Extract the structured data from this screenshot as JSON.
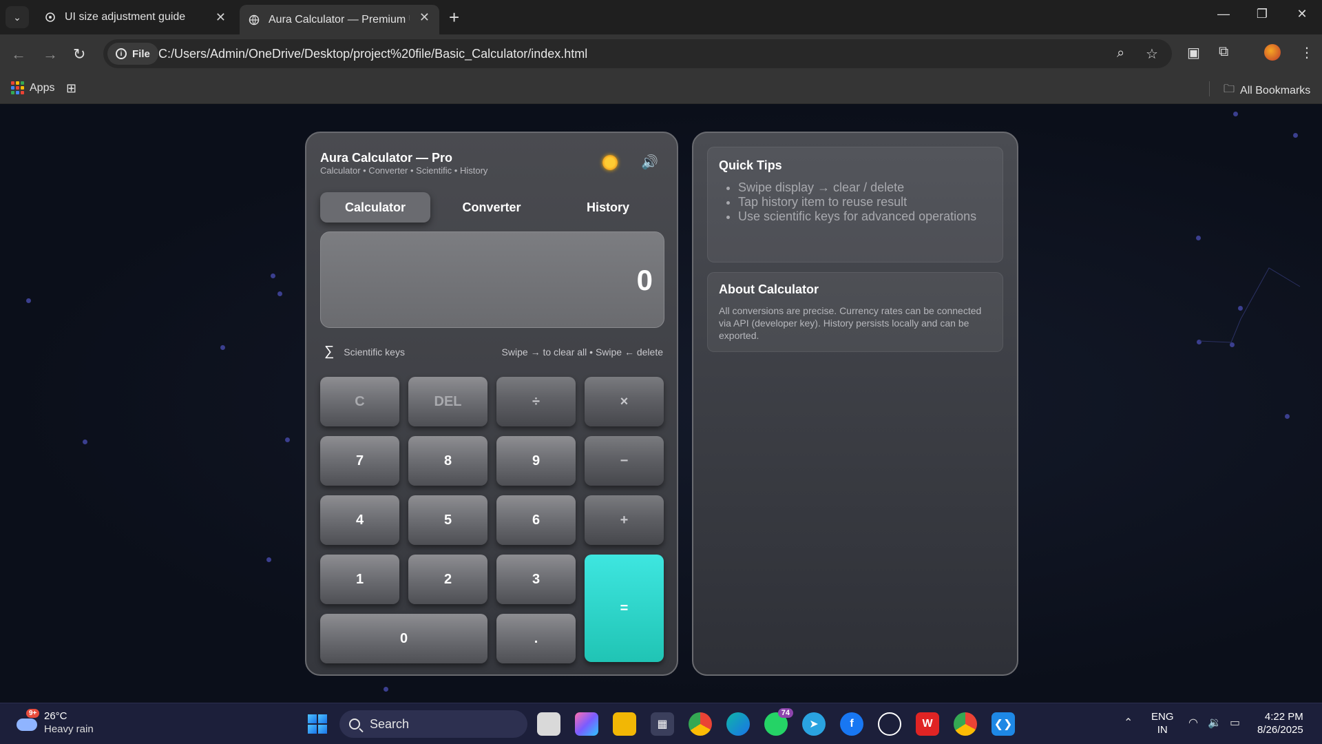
{
  "browser": {
    "tabs": [
      {
        "title": "UI size adjustment guide"
      },
      {
        "title": "Aura Calculator — Premium UI"
      }
    ],
    "address": {
      "scheme_label": "File",
      "url": "C:/Users/Admin/OneDrive/Desktop/project%20file/Basic_Calculator/index.html"
    },
    "bookmarks": {
      "apps_label": "Apps",
      "all_bookmarks_label": "All Bookmarks"
    }
  },
  "calculator": {
    "title": "Aura Calculator — Pro",
    "subtitle": "Calculator • Converter • Scientific • History",
    "tabs": [
      "Calculator",
      "Converter",
      "History"
    ],
    "active_tab": "Calculator",
    "display_value": "0",
    "scientific_label": "Scientific keys",
    "sigma_symbol": "∑",
    "swipe_hint": "Swipe → to clear all • Swipe ← delete",
    "keys": {
      "clear": "C",
      "del": "DEL",
      "divide": "÷",
      "multiply": "×",
      "seven": "7",
      "eight": "8",
      "nine": "9",
      "minus": "−",
      "four": "4",
      "five": "5",
      "six": "6",
      "plus": "+",
      "one": "1",
      "two": "2",
      "three": "3",
      "equals": "=",
      "zero": "0",
      "dot": "."
    }
  },
  "side": {
    "tips_title": "Quick Tips",
    "tips": [
      "Swipe display → clear / delete",
      "Tap history item to reuse result",
      "Use scientific keys for advanced operations"
    ],
    "about_title": "About Calculator",
    "about_text": "All conversions are precise. Currency rates can be connected via API (developer key). History persists locally and can be exported."
  },
  "taskbar": {
    "weather_temp": "26°C",
    "weather_desc": "Heavy rain",
    "weather_badge": "9+",
    "search_label": "Search",
    "whatsapp_badge": "74",
    "lang_line1": "ENG",
    "lang_line2": "IN",
    "time": "4:22 PM",
    "date": "8/26/2025"
  },
  "colors": {
    "accent_equals": "#22c9bb",
    "page_bg": "#0b0f1a",
    "taskbar_bg": "#1c1f3a"
  }
}
